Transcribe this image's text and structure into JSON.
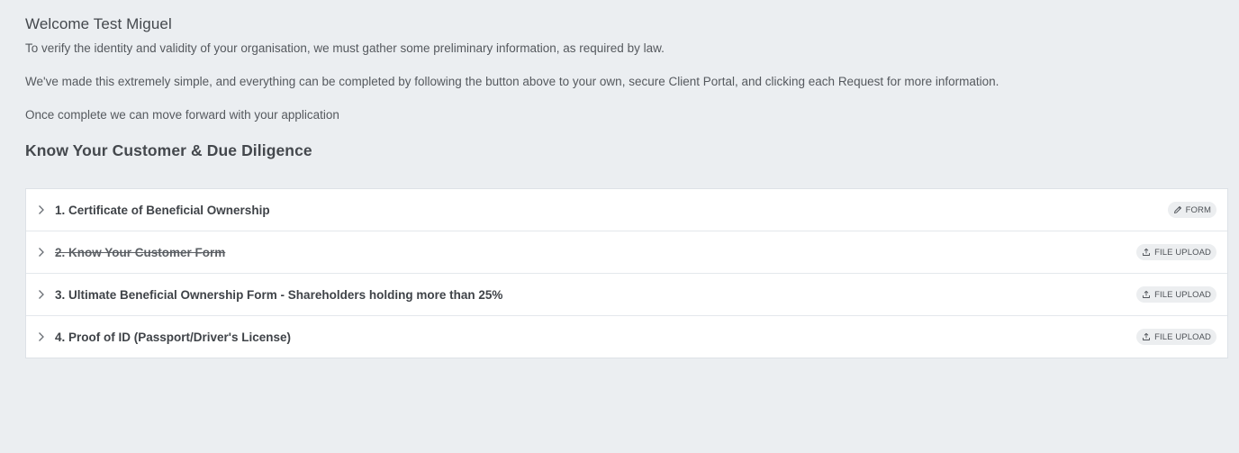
{
  "welcome": "Welcome Test Miguel",
  "paragraphs": [
    "To verify the identity and validity of your organisation, we must gather some preliminary information, as required by law.",
    "We've made this extremely simple, and everything can be completed by following the button above to your own, secure Client Portal, and clicking each Request for more information.",
    "Once complete we can move forward with your application"
  ],
  "section_title": "Know Your Customer & Due Diligence",
  "requests": [
    {
      "title": "1. Certificate of Beneficial Ownership",
      "badge": "FORM",
      "badge_icon": "pencil-icon",
      "completed": false
    },
    {
      "title": "2. Know Your Customer Form",
      "badge": "FILE UPLOAD",
      "badge_icon": "upload-icon",
      "completed": true
    },
    {
      "title": "3. Ultimate Beneficial Ownership Form - Shareholders holding more than 25%",
      "badge": "FILE UPLOAD",
      "badge_icon": "upload-icon",
      "completed": false
    },
    {
      "title": "4. Proof of ID (Passport/Driver's License)",
      "badge": "FILE UPLOAD",
      "badge_icon": "upload-icon",
      "completed": false
    }
  ]
}
